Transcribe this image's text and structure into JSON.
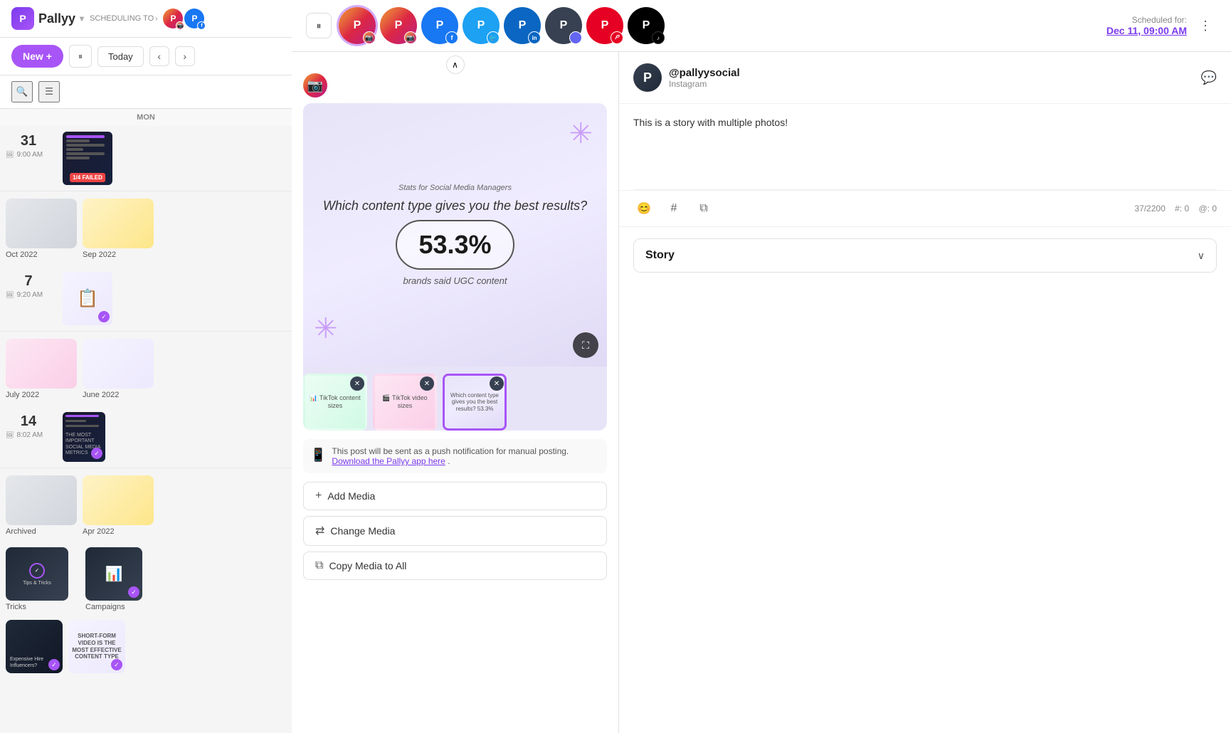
{
  "brand": {
    "name": "Pallyy",
    "logo_letter": "P"
  },
  "header": {
    "scheduling_to": "SCHEDULING TO",
    "pause_icon": "⏸",
    "new_label": "New",
    "today_label": "Today",
    "prev_icon": "‹",
    "next_icon": "›"
  },
  "scheduled": {
    "label": "Scheduled for:",
    "date": "Dec 11, 09:00 AM"
  },
  "calendar": {
    "days": [
      {
        "day": "MON",
        "date": "31",
        "entries": [
          {
            "time": "9:00 AM",
            "has_image": true,
            "label": "1/4 FAILED"
          }
        ]
      },
      {
        "day": "",
        "date": "7",
        "entries": [
          {
            "time": "9:20 AM",
            "has_image": true
          }
        ]
      },
      {
        "day": "",
        "date": "14",
        "entries": [
          {
            "time": "8:02 AM",
            "has_image": true
          }
        ]
      }
    ],
    "folders": [
      {
        "label": "Oct 2022",
        "color": "grey"
      },
      {
        "label": "Sep 2022",
        "color": "tan"
      },
      {
        "label": "July 2022",
        "color": "pink"
      },
      {
        "label": "June 2022",
        "color": "lavender"
      },
      {
        "label": "Archived",
        "color": "grey2"
      },
      {
        "label": "Apr 2022",
        "color": "tan2"
      }
    ]
  },
  "sidebar_items": [
    {
      "label": "Tricks",
      "type": "folder"
    },
    {
      "label": "Campaigns",
      "type": "folder"
    }
  ],
  "sidebar_items2": [
    {
      "label": "Tips & Tricks",
      "type": "post"
    },
    {
      "label": "",
      "type": "post2"
    }
  ],
  "modal": {
    "platform_icons": [
      {
        "name": "instagram",
        "letter": "P",
        "badge": "📷",
        "active": true
      },
      {
        "name": "instagram2",
        "letter": "P",
        "badge": "📷"
      },
      {
        "name": "facebook",
        "letter": "P",
        "badge": "f"
      },
      {
        "name": "twitter",
        "letter": "P",
        "badge": "🐦"
      },
      {
        "name": "linkedin",
        "letter": "P",
        "badge": "in"
      },
      {
        "name": "generic1",
        "letter": "P",
        "badge": ""
      },
      {
        "name": "pinterest",
        "letter": "P",
        "badge": "𝑃"
      },
      {
        "name": "tiktok",
        "letter": "P",
        "badge": "♪"
      }
    ],
    "account": {
      "handle": "@pallyysocial",
      "platform": "Instagram",
      "avatar_letter": "P"
    },
    "caption": "This is a story with multiple photos!",
    "char_count": "37/2200",
    "hash_count": "#: 0",
    "at_count": "@: 0",
    "story_label": "Story",
    "push_notification_text": "This post will be sent as a push notification for manual posting.",
    "push_link_text": "Download the Pallyy app here",
    "push_link_suffix": ".",
    "buttons": {
      "add_media": "Add Media",
      "change_media": "Change Media",
      "copy_media": "Copy Media to All"
    },
    "media": {
      "header_text": "Stats for Social Media Managers",
      "question": "Which content type gives you the best results?",
      "percent": "53.3%",
      "sub_label": "brands said UGC content"
    },
    "thumbnails": [
      {
        "id": 1,
        "type": "table",
        "selected": false
      },
      {
        "id": 2,
        "type": "video",
        "selected": false
      },
      {
        "id": 3,
        "type": "stats",
        "selected": true
      }
    ]
  },
  "icons": {
    "search": "🔍",
    "list": "☰",
    "plus": "+",
    "pause_bars": "⏸",
    "chevron_down": "∨",
    "chevron_up": "∧",
    "emoji": "😊",
    "hashtag": "#",
    "copy": "⧉",
    "phone": "📱",
    "swap": "⇄",
    "fullscreen": "⛶",
    "close": "✕",
    "more_dots": "⋮"
  },
  "colors": {
    "purple": "#a855f7",
    "dark_purple": "#7c3aed",
    "instagram_grad_start": "#f09433",
    "instagram_grad_end": "#bc1888",
    "facebook": "#1877f2",
    "twitter": "#1da1f2",
    "linkedin": "#0a66c2",
    "pinterest": "#e60023",
    "tiktok": "#000000",
    "failed_red": "#ef4444"
  }
}
